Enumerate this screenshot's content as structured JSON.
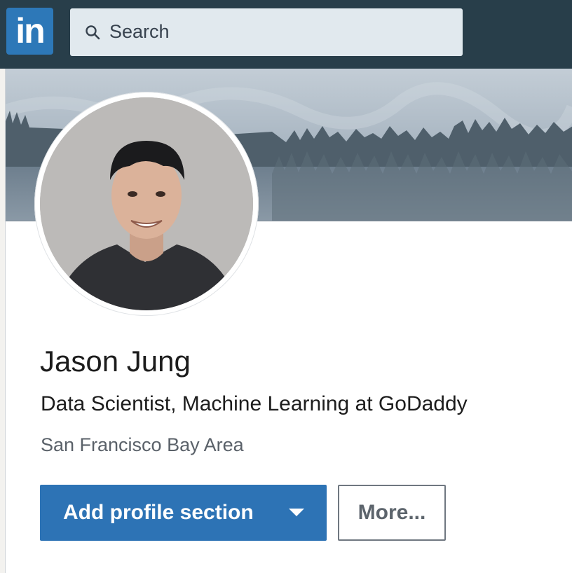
{
  "nav": {
    "logo_text": "in",
    "search": {
      "placeholder": "Search",
      "icon": "search-icon"
    }
  },
  "profile": {
    "name": "Jason Jung",
    "headline": "Data Scientist, Machine Learning at GoDaddy",
    "location": "San Francisco Bay Area",
    "photo": "avatar-photo"
  },
  "actions": {
    "add_section_label": "Add profile section",
    "more_label": "More..."
  },
  "colors": {
    "nav_bg": "#283e4a",
    "brand": "#2d78b8",
    "primary_button": "#2d73b5",
    "search_bg": "#e1e9ee"
  }
}
